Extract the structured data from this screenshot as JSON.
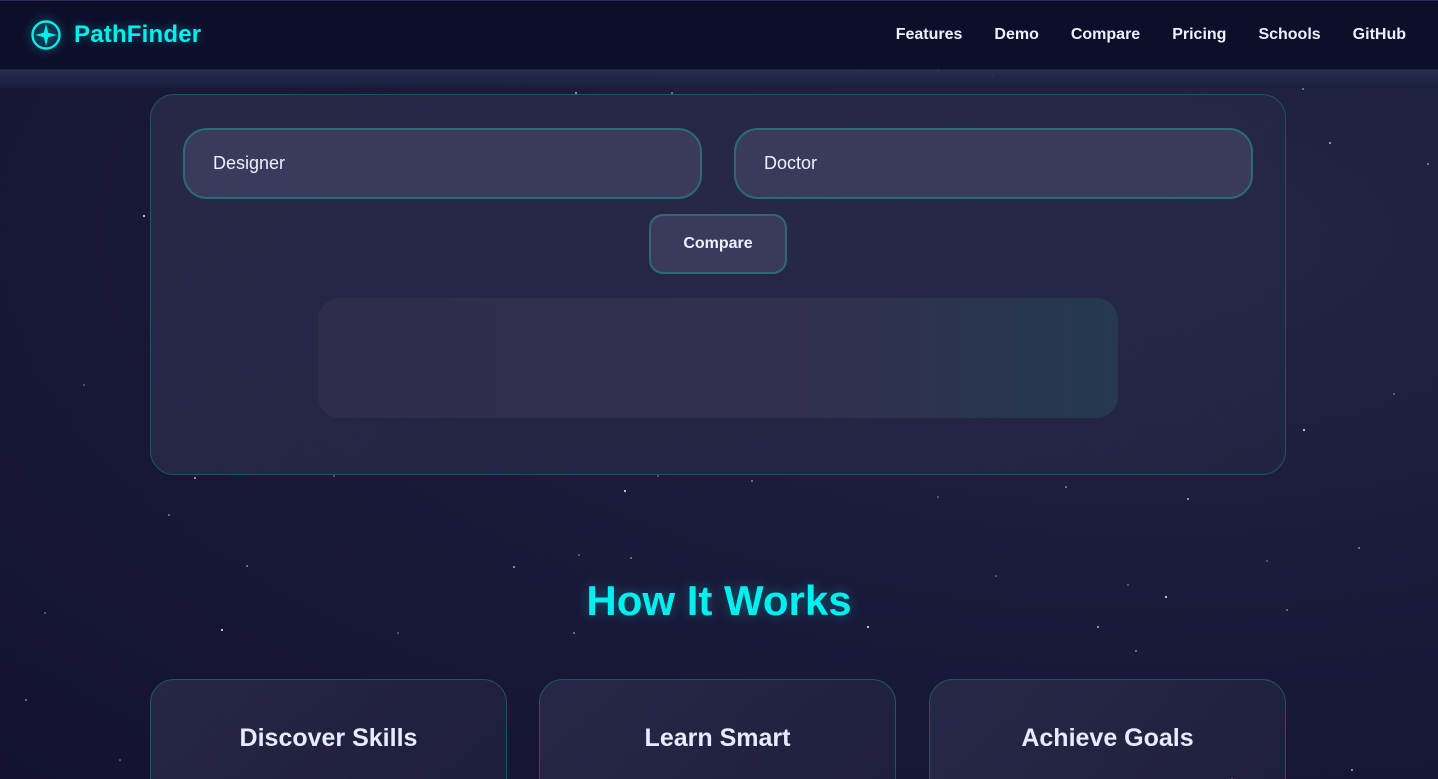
{
  "header": {
    "brand_name": "PathFinder",
    "brand_icon": "compass-star-icon",
    "nav": [
      {
        "label": "Features"
      },
      {
        "label": "Demo"
      },
      {
        "label": "Compare"
      },
      {
        "label": "Pricing"
      },
      {
        "label": "Schools"
      },
      {
        "label": "GitHub"
      }
    ]
  },
  "compare": {
    "career_a": "Designer",
    "career_b": "Doctor",
    "button_label": "Compare",
    "result": ""
  },
  "how_it_works": {
    "title": "How It Works",
    "steps": [
      {
        "title": "Discover Skills",
        "text": ""
      },
      {
        "title": "Learn Smart",
        "text": ""
      },
      {
        "title": "Achieve Goals",
        "text": ""
      }
    ]
  },
  "colors": {
    "accent": "#00f0ef",
    "background": "#1a1b3a",
    "header": "#0d0e2a",
    "border": "#2c6b73"
  }
}
